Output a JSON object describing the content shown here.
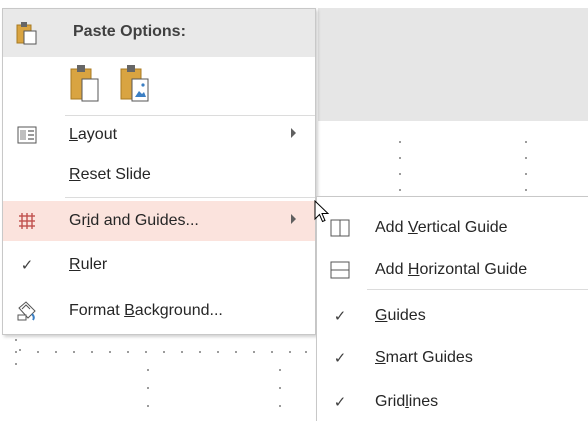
{
  "menu": {
    "paste_options_label": "Paste Options:",
    "items": [
      {
        "label_pre": "",
        "label_u": "L",
        "label_post": "ayout",
        "icon": "layout-icon",
        "submenu": true
      },
      {
        "label_pre": "",
        "label_u": "R",
        "label_post": "eset Slide",
        "icon": "",
        "submenu": false
      },
      {
        "label_pre": "Gr",
        "label_u": "i",
        "label_post": "d and Guides...",
        "icon": "grid-icon",
        "submenu": true
      },
      {
        "label_pre": "",
        "label_u": "R",
        "label_post": "uler",
        "icon": "check-icon",
        "submenu": false
      },
      {
        "label_pre": "Format ",
        "label_u": "B",
        "label_post": "ackground...",
        "icon": "format-background-icon",
        "submenu": false
      }
    ]
  },
  "submenu": {
    "items": [
      {
        "label_pre": "Add ",
        "label_u": "V",
        "label_post": "ertical Guide",
        "icon": "vertical-guide-icon"
      },
      {
        "label_pre": "Add ",
        "label_u": "H",
        "label_post": "orizontal Guide",
        "icon": "horizontal-guide-icon"
      },
      {
        "label_pre": "",
        "label_u": "G",
        "label_post": "uides",
        "icon": "check-icon",
        "checked": true
      },
      {
        "label_pre": "",
        "label_u": "S",
        "label_post": "mart Guides",
        "icon": "check-icon",
        "checked": true
      },
      {
        "label_pre": "Grid",
        "label_u": "l",
        "label_post": "ines",
        "icon": "check-icon",
        "checked": true
      }
    ]
  },
  "colors": {
    "highlight": "#fbe3dd",
    "paste_header": "#e9e9e9",
    "clipboard": "#d9a441",
    "grid_icon": "#c0504d"
  }
}
